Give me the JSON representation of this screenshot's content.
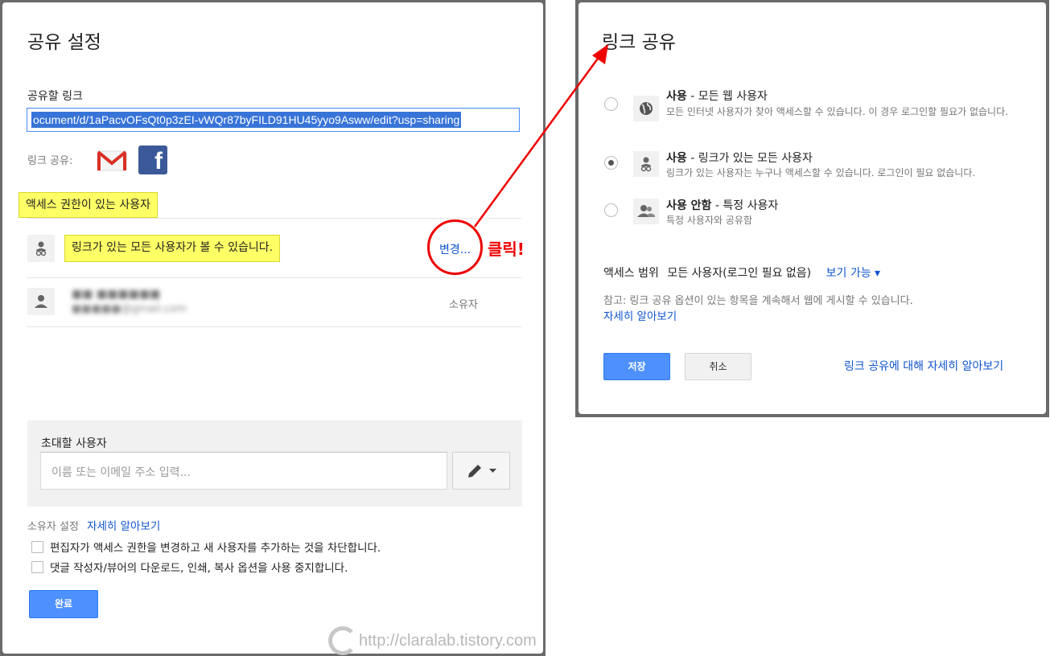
{
  "left_dialog": {
    "title": "공유 설정",
    "link_label": "공유할 링크",
    "link_value": "ocument/d/1aPacvOFsQt0p3zEI-vWQr87byFILD91HU45yyo9Asww/edit?usp=sharing",
    "share_via_label": "링크 공유:",
    "access_heading": "액세스 권한이 있는 사용자",
    "link_access_text": "링크가 있는 모든 사용자가 볼 수 있습니다.",
    "change_link": "변경...",
    "annotation": "클릭!",
    "owner": {
      "name": "■■ ■■■■■■",
      "email": "■■■■■@gmail.com",
      "role": "소유자"
    },
    "invite": {
      "label": "초대할 사용자",
      "placeholder": "이름 또는 이메일 주소 입력..."
    },
    "owner_settings": {
      "label": "소유자 설정",
      "link": "자세히 알아보기"
    },
    "checkboxes": [
      "편집자가 액세스 권한을 변경하고 새 사용자를 추가하는 것을 차단합니다.",
      "댓글 작성자/뷰어의 다운로드, 인쇄, 복사 옵션을 사용 중지합니다."
    ],
    "done_button": "완료",
    "watermark": "http://claralab.tistory.com"
  },
  "right_dialog": {
    "title": "링크 공유",
    "options": [
      {
        "title_bold": "사용",
        "title_rest": " - 모든 웹 사용자",
        "desc": "모든 인터넷 사용자가 찾아 액세스할 수 있습니다. 이 경우 로그인할 필요가 없습니다.",
        "selected": false,
        "icon": "globe-icon"
      },
      {
        "title_bold": "사용",
        "title_rest": " - 링크가 있는 모든 사용자",
        "desc": "링크가 있는 사용자는 누구나 액세스할 수 있습니다. 로그인이 필요 없습니다.",
        "selected": true,
        "icon": "person-link-icon"
      },
      {
        "title_bold": "사용 안함",
        "title_rest": " - 특정 사용자",
        "desc": "특정 사용자와 공유함",
        "selected": false,
        "icon": "people-icon"
      }
    ],
    "scope_label": "액세스 범위",
    "scope_value": "모든 사용자(로그인 필요 없음)",
    "scope_permission": "보기 가능 ▾",
    "note": "참고: 링크 공유 옵션이 있는 항목을 계속해서 웹에 게시할 수 있습니다.",
    "note_link": "자세히 알아보기",
    "save_button": "저장",
    "cancel_button": "취소",
    "learn_more": "링크 공유에 대해 자세히 알아보기"
  },
  "colors": {
    "accent": "#4d90fe",
    "link": "#1155cc",
    "highlight": "#ffff66",
    "annotation": "#ee0000"
  }
}
